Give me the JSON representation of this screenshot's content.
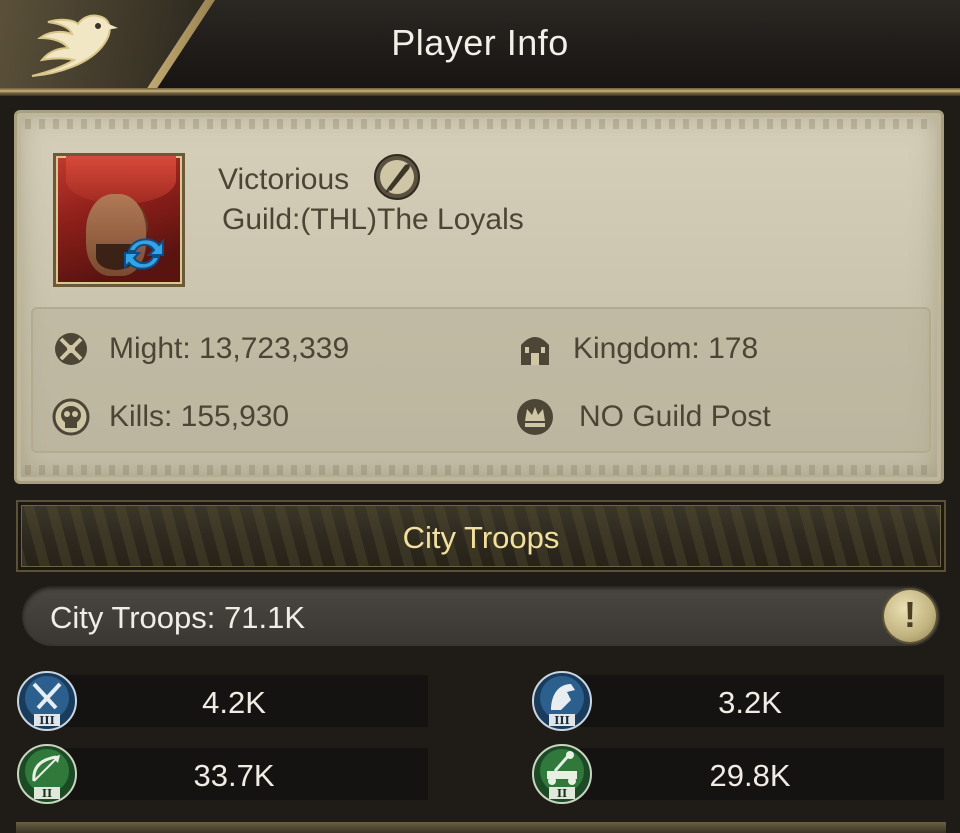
{
  "header": {
    "title": "Player Info",
    "back_icon": "eagle-back-icon"
  },
  "profile": {
    "name": "Victorious",
    "title_icon": "quill-icon",
    "guild": "Guild:(THL)The Loyals",
    "swap_icon": "swap-arrow-icon",
    "stats": {
      "might": "Might: 13,723,339",
      "kingdom": "Kingdom: 178",
      "kills": "Kills: 155,930",
      "guild_post": "NO Guild Post"
    }
  },
  "city_troops": {
    "banner": "City Troops",
    "total": "City Troops: 71.1K",
    "info_glyph": "!",
    "troops": [
      {
        "icon": "infantry-tier3-icon",
        "tier": "III",
        "value": "4.2K",
        "color": "#2b5f8e"
      },
      {
        "icon": "cavalry-tier3-icon",
        "tier": "III",
        "value": "3.2K",
        "color": "#2b5f8e"
      },
      {
        "icon": "ranged-tier2-icon",
        "tier": "II",
        "value": "33.7K",
        "color": "#2f7a3a"
      },
      {
        "icon": "siege-tier2-icon",
        "tier": "II",
        "value": "29.8K",
        "color": "#2f7a3a"
      }
    ]
  },
  "colors": {
    "accent_gold": "#f2e19a",
    "card_bg": "#cbc5af",
    "text_dark": "#4b4535"
  }
}
